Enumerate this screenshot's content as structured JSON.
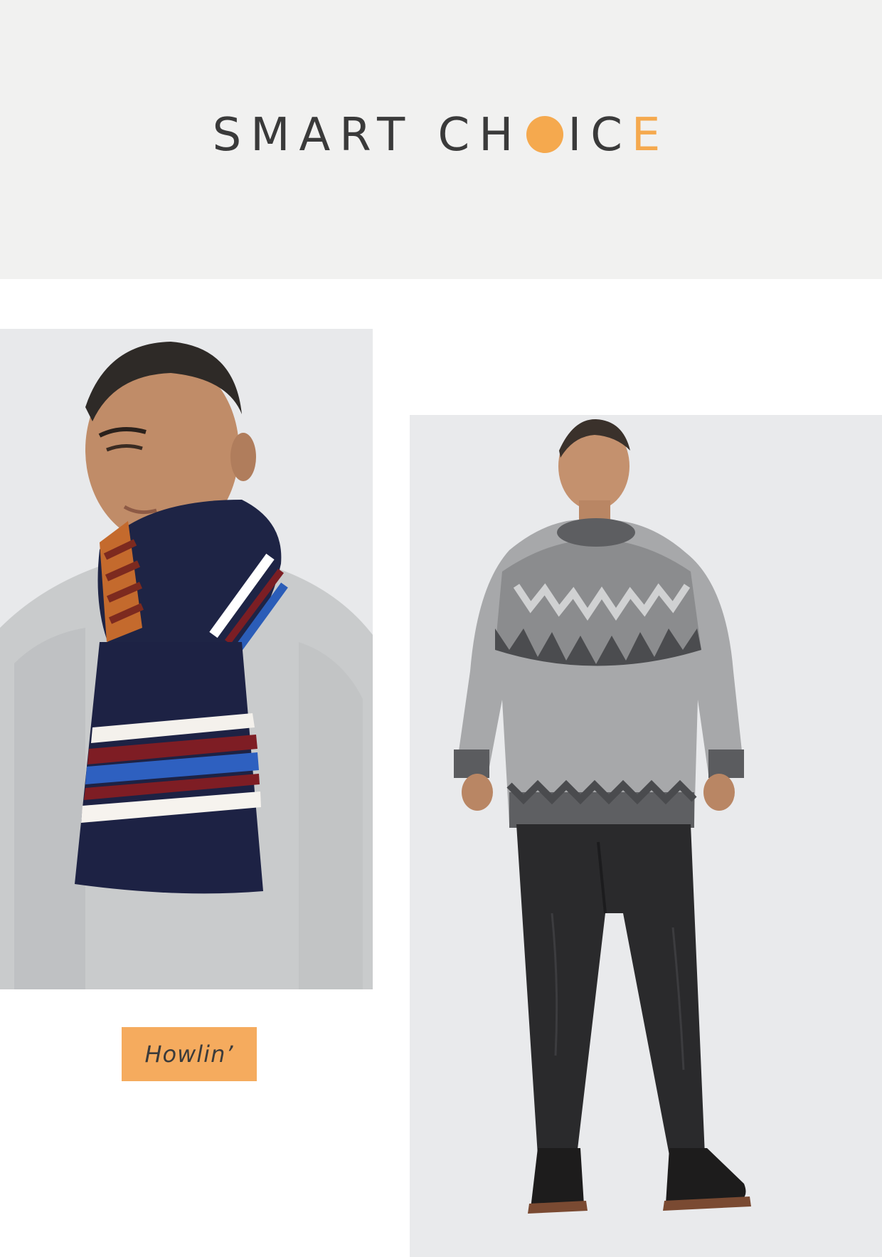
{
  "logo": {
    "part1": "SMART CH",
    "part2": "IC",
    "part3": "E",
    "dot_color": "#f5a94e",
    "accent_color": "#f5a94e"
  },
  "products": {
    "left": {
      "icon": "man-with-striped-scarf-photo"
    },
    "right": {
      "icon": "man-in-fair-isle-sweater-photo"
    }
  },
  "brand_tag": {
    "label": "Howlin’",
    "color": "#f5ab5e"
  }
}
